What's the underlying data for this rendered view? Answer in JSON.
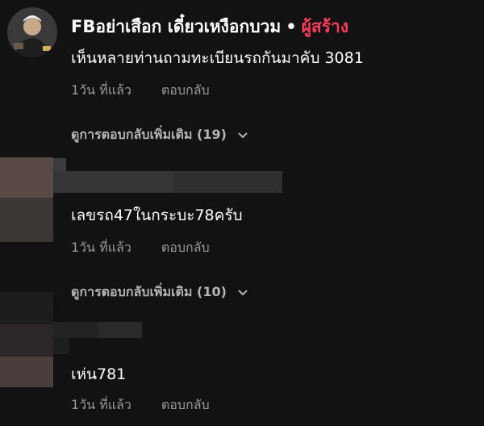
{
  "comments": [
    {
      "author": "FBอย่าเสือก เดี๋ยวเหงือกบวม",
      "separator": "•",
      "creator_badge": "ผู้สร้าง",
      "text": "เห็นหลายท่านถามทะเบียนรถกันมาคับ 3081",
      "time": "1วัน ที่แล้ว",
      "reply_label": "ตอบกลับ",
      "more_replies": "ดูการตอบกลับเพิ่มเติม (19)"
    },
    {
      "text": "เลขรถ47ในกระบะ78ครับ",
      "time": "1วัน ที่แล้ว",
      "reply_label": "ตอบกลับ",
      "more_replies": "ดูการตอบกลับเพิ่มเติม (10)"
    },
    {
      "text": "เห่น781",
      "time": "1วัน ที่แล้ว",
      "reply_label": "ตอบกลับ"
    }
  ],
  "colors": {
    "background": "#121212",
    "creator_badge": "#ff3b5c",
    "meta_text": "#9a9a9a",
    "more_text": "#b5b5b5"
  },
  "icons": [
    "chevron-down-icon"
  ]
}
